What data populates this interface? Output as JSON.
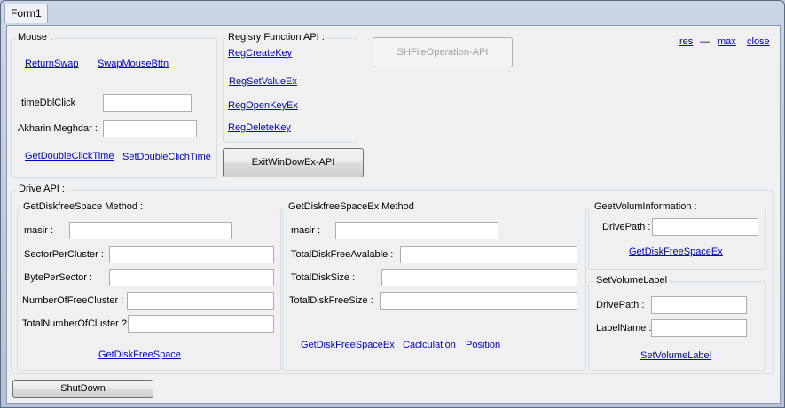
{
  "window": {
    "title": "Form1"
  },
  "top_links": {
    "res": "res",
    "dash": "—",
    "max": "max",
    "close": "close"
  },
  "mouse_group": {
    "label": "Mouse :",
    "return_swap": "ReturnSwap",
    "swap_mouse_button": "SwapMouseBttn",
    "time_dbl_click_label": "timeDblClick",
    "time_dbl_click_value": "",
    "akharin_meghdar_label": "Akharin Meghdar :",
    "akharin_meghdar_value": "",
    "get_double_click_time": "GetDoubleClickTime",
    "set_double_click_time": "SetDoubleClichTime"
  },
  "registry_group": {
    "label": "Regisry Function API :",
    "reg_create_key": "RegCreateKey",
    "reg_set_value_ex": "RegSetValueEx",
    "reg_open_key_ex": "RegOpenKeyEx",
    "reg_delete_key": "RegDeleteKey"
  },
  "shfileoperation_button": "SHFileOperation-API",
  "exit_windows_button": "ExitWinDowEx-API",
  "drive_group": {
    "label": "Drive API :",
    "diskfree": {
      "label": "GetDiskfreeSpace Method :",
      "masir_label": "masir :",
      "sector_per_cluster_label": "SectorPerCluster :",
      "byte_per_sector_label": "BytePerSector :",
      "number_of_free_cluster_label": "NumberOfFreeCluster :",
      "total_number_of_cluster_label": "TotalNumberOfCluster ?:",
      "get_disk_free_space": "GetDiskFreeSpace"
    },
    "diskfree_ex": {
      "label": "GetDiskfreeSpaceEx Method",
      "masir_label": "masir :",
      "total_disk_free_available_label": "TotalDiskFreeAvalable :",
      "total_disk_size_label": "TotalDiskSize :",
      "total_disk_free_size_label": "TotalDiskFreeSize :",
      "get_disk_free_space_ex": "GetDiskFreeSpaceEx",
      "calculation": "Caclculation",
      "position": "Position"
    },
    "volume_info": {
      "label": "GeetVolumInformation  :",
      "drive_path_label": "DrivePath :",
      "get_disk_free_space_ex": "GetDiskFreeSpaceEx"
    },
    "set_volume_label": {
      "label": "SetVolumeLabel",
      "drive_path_label": "DrivePath :",
      "label_name_label": "LabelName :",
      "set_volume_label_link": "SetVolumeLabel"
    }
  },
  "shutdown_button": "ShutDown"
}
